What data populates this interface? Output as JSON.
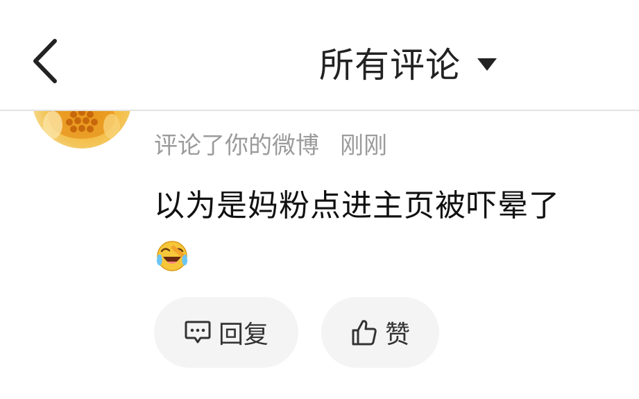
{
  "header": {
    "title": "所有评论",
    "back_icon": "chevron-left-icon",
    "dropdown_icon": "caret-down-icon"
  },
  "comment": {
    "action_text": "评论了你的微博",
    "time": "刚刚",
    "text": "以为是妈粉点进主页被吓晕了",
    "emoji": "laughing-crying-emoji"
  },
  "actions": {
    "reply_label": "回复",
    "like_label": "赞"
  },
  "colors": {
    "background": "#ffffff",
    "divider": "#e3e3e3",
    "meta_text": "#9b9b9b",
    "pill_bg": "#f4f4f4"
  }
}
